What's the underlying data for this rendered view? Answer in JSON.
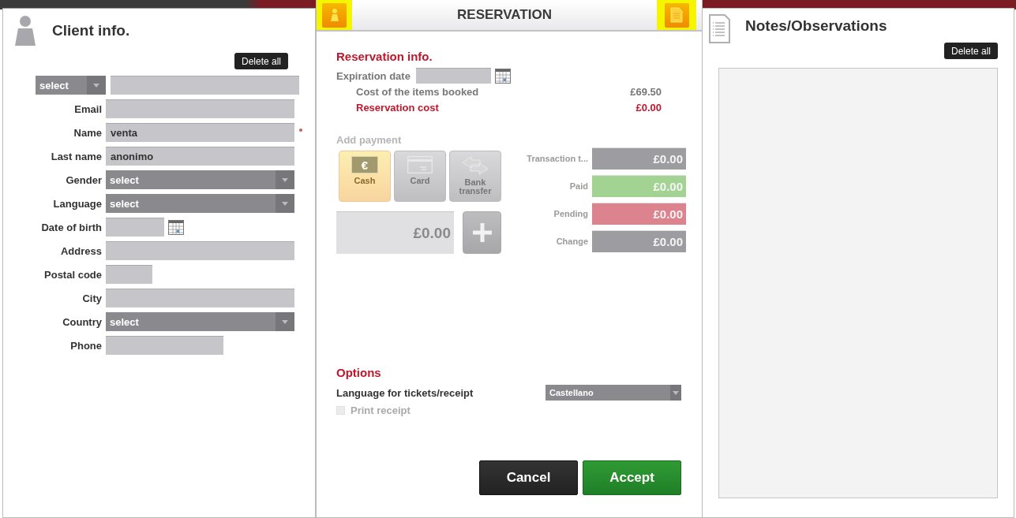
{
  "client_panel": {
    "title": "Client info.",
    "delete_button": "Delete all",
    "fields": [
      {
        "kind": "prefix_select",
        "select": "select",
        "required": false
      },
      {
        "kind": "text",
        "label": "Email",
        "required": false
      },
      {
        "kind": "text",
        "label": "Name",
        "value": "venta",
        "required": true
      },
      {
        "kind": "text",
        "label": "Last name",
        "value": "anonimo",
        "required": false
      },
      {
        "kind": "select",
        "label": "Gender",
        "value": "select",
        "required": false
      },
      {
        "kind": "select",
        "label": "Language",
        "value": "select",
        "required": false
      },
      {
        "kind": "date",
        "label": "Date of birth",
        "required": false
      },
      {
        "kind": "text",
        "label": "Address",
        "required": false
      },
      {
        "kind": "short_text",
        "label": "Postal code",
        "required": false
      },
      {
        "kind": "text",
        "label": "City",
        "required": false
      },
      {
        "kind": "select",
        "label": "Country",
        "value": "select",
        "required": false
      },
      {
        "kind": "medium_text",
        "label": "Phone",
        "required": false
      }
    ]
  },
  "reservation_panel": {
    "title": "RESERVATION",
    "reservation_info": {
      "heading": "Reservation info.",
      "expiration_label": "Expiration date",
      "costs": [
        {
          "kind": "normal",
          "label": "Cost of the items booked",
          "value": "£69.50"
        },
        {
          "kind": "highlight",
          "label": "Reservation cost",
          "value": "£0.00"
        }
      ]
    },
    "payment": {
      "heading": "Add payment",
      "methods": [
        {
          "kind": "cash",
          "label": "Cash",
          "icon_text": "€",
          "selected": true
        },
        {
          "kind": "card",
          "label": "Card",
          "selected": false
        },
        {
          "kind": "transfer",
          "label": "Bank transfer",
          "selected": false
        }
      ],
      "amount": "£0.00",
      "totals": [
        {
          "kind": "neutral",
          "label": "Transaction t...",
          "value": "£0.00"
        },
        {
          "kind": "paid",
          "label": "Paid",
          "value": "£0.00"
        },
        {
          "kind": "pending",
          "label": "Pending",
          "value": "£0.00"
        },
        {
          "kind": "neutral",
          "label": "Change",
          "value": "£0.00"
        }
      ]
    },
    "options": {
      "heading": "Options",
      "language_label": "Language for tickets/receipt",
      "language_value": "Castellano",
      "print_receipt": {
        "label": "Print receipt",
        "checked": false,
        "disabled": true
      }
    },
    "buttons": [
      {
        "kind": "cancel",
        "label": "Cancel"
      },
      {
        "kind": "accept",
        "label": "Accept"
      }
    ]
  },
  "notes_panel": {
    "title": "Notes/Observations",
    "delete_button": "Delete all"
  }
}
